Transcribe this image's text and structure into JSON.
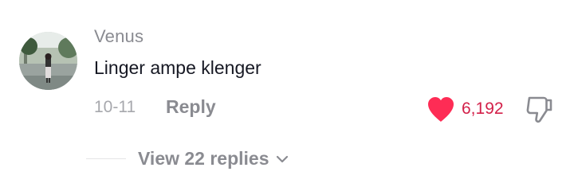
{
  "comment": {
    "username": "Venus",
    "text": "Linger ampe klenger",
    "date": "10-11",
    "reply_label": "Reply",
    "like_count": "6,192",
    "liked": true,
    "colors": {
      "like_active": "#fe2c55",
      "like_count_text": "#d32049",
      "secondary_text": "#8a8b91"
    }
  },
  "replies": {
    "label": "View 22 replies"
  },
  "icons": {
    "like": "heart-icon",
    "dislike": "thumbs-down-icon",
    "expand": "chevron-down-icon"
  }
}
